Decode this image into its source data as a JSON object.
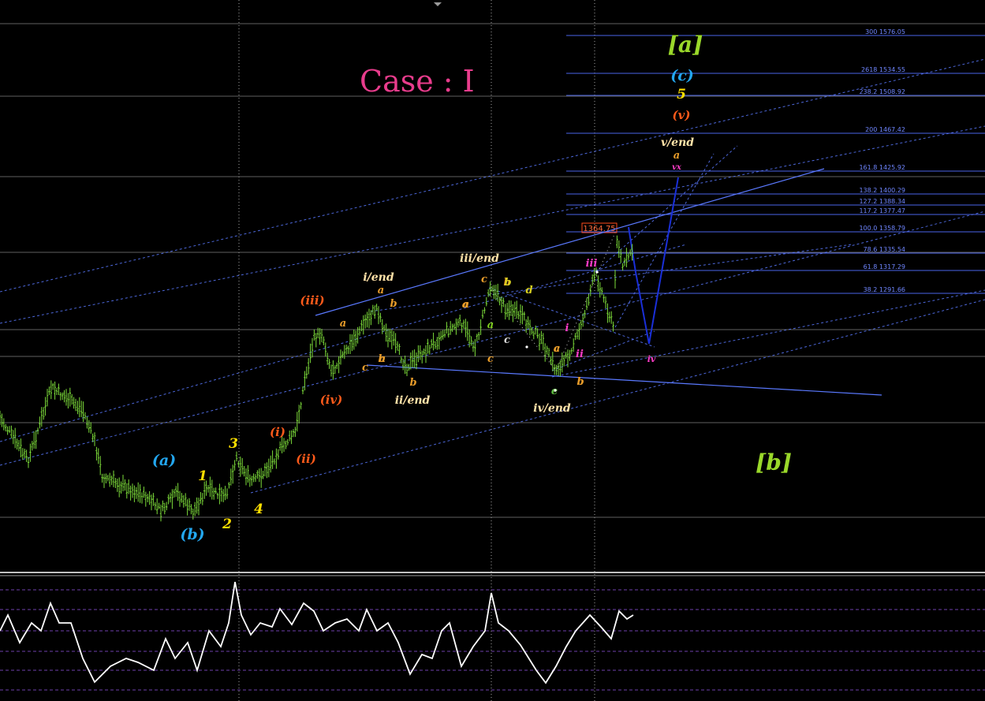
{
  "title": "Case : I",
  "colors": {
    "background": "#000000",
    "price": "#7ddc3a",
    "fib_line": "#4a63e8",
    "fib_text": "#6f86ff",
    "grid": "#d0d0d0",
    "channel": "#5a79ff",
    "projection": "#1a2fd8",
    "oscillator": "#ffffff",
    "title": "#e83c8c"
  },
  "chart_data": {
    "type": "line",
    "price_marker": "1364.75",
    "fib_levels": [
      {
        "ratio": "300",
        "price": "1576.05"
      },
      {
        "ratio": "2618",
        "price": "1534.55"
      },
      {
        "ratio": "238.2",
        "price": "1508.92"
      },
      {
        "ratio": "200",
        "price": "1467.42"
      },
      {
        "ratio": "161.8",
        "price": "1425.92"
      },
      {
        "ratio": "138.2",
        "price": "1400.29"
      },
      {
        "ratio": "127.2",
        "price": "1388.34"
      },
      {
        "ratio": "117.2",
        "price": "1377.47"
      },
      {
        "ratio": "100.0",
        "price": "1358.79"
      },
      {
        "ratio": "78.6",
        "price": "1335.54"
      },
      {
        "ratio": "61.8",
        "price": "1317.29"
      },
      {
        "ratio": "38.2",
        "price": "1291.66"
      }
    ],
    "wave_labels": [
      {
        "text": "(a)",
        "color": "#23a7f0",
        "size": 19
      },
      {
        "text": "(b)",
        "color": "#23a7f0",
        "size": 19
      },
      {
        "text": "1",
        "color": "#ffe000",
        "size": 17
      },
      {
        "text": "2",
        "color": "#ffe000",
        "size": 17
      },
      {
        "text": "3",
        "color": "#ffe000",
        "size": 17
      },
      {
        "text": "4",
        "color": "#ffe000",
        "size": 17
      },
      {
        "text": "(i)",
        "color": "#ff5a1a",
        "size": 15
      },
      {
        "text": "(ii)",
        "color": "#ff5a1a",
        "size": 15
      },
      {
        "text": "(iii)",
        "color": "#ff5a1a",
        "size": 15
      },
      {
        "text": "(iv)",
        "color": "#ff5a1a",
        "size": 15
      },
      {
        "text": "i/end",
        "color": "#ffe2a8",
        "size": 14
      },
      {
        "text": "ii/end",
        "color": "#ffe2a8",
        "size": 14
      },
      {
        "text": "iii/end",
        "color": "#ffe2a8",
        "size": 14
      },
      {
        "text": "iv/end",
        "color": "#ffe2a8",
        "size": 14
      },
      {
        "text": "v/end",
        "color": "#ffe2a8",
        "size": 14
      },
      {
        "text": "a",
        "color": "#e89c2a",
        "size": 13
      },
      {
        "text": "b",
        "color": "#e89c2a",
        "size": 13
      },
      {
        "text": "c",
        "color": "#e89c2a",
        "size": 13
      },
      {
        "text": "a",
        "color": "#e89c2a",
        "size": 13
      },
      {
        "text": "b",
        "color": "#e89c2a",
        "size": 13
      },
      {
        "text": "a",
        "color": "#e89c2a",
        "size": 13
      },
      {
        "text": "b",
        "color": "#e89c2a",
        "size": 13
      },
      {
        "text": "c",
        "color": "#e89c2a",
        "size": 13
      },
      {
        "text": "a",
        "color": "#e89c2a",
        "size": 13
      },
      {
        "text": "b",
        "color": "#e89c2a",
        "size": 13
      },
      {
        "text": "c",
        "color": "#e89c2a",
        "size": 13
      },
      {
        "text": "a",
        "color": "#e89c2a",
        "size": 13
      },
      {
        "text": "b",
        "color": "#e89c2a",
        "size": 13
      },
      {
        "text": "c",
        "color": "#e89c2a",
        "size": 13
      },
      {
        "text": "a",
        "color": "#80d020",
        "size": 13
      },
      {
        "text": "b",
        "color": "#d8d020",
        "size": 13
      },
      {
        "text": "c",
        "color": "#d8d8d8",
        "size": 13
      },
      {
        "text": "d",
        "color": "#d8d020",
        "size": 13
      },
      {
        "text": "e",
        "color": "#60c040",
        "size": 13
      },
      {
        "text": "a",
        "color": "#e89c2a",
        "size": 13
      },
      {
        "text": "b",
        "color": "#e89c2a",
        "size": 13
      },
      {
        "text": "a",
        "color": "#e89c2a",
        "size": 13
      },
      {
        "text": "i",
        "color": "#ff3cc8",
        "size": 13
      },
      {
        "text": "ii",
        "color": "#ff3cc8",
        "size": 13
      },
      {
        "text": "iii",
        "color": "#ff3cc8",
        "size": 13
      },
      {
        "text": "iv",
        "color": "#ff3cc8",
        "size": 11
      },
      {
        "text": "vx",
        "color": "#ff3cc8",
        "size": 10
      },
      {
        "text": "(v)",
        "color": "#ff5a1a",
        "size": 15
      },
      {
        "text": "5",
        "color": "#ffe000",
        "size": 17
      },
      {
        "text": "(c)",
        "color": "#23a7f0",
        "size": 19
      },
      {
        "text": "[a]",
        "color": "#9ad82a",
        "size": 28
      },
      {
        "text": "[b]",
        "color": "#9ad82a",
        "size": 28
      }
    ]
  }
}
